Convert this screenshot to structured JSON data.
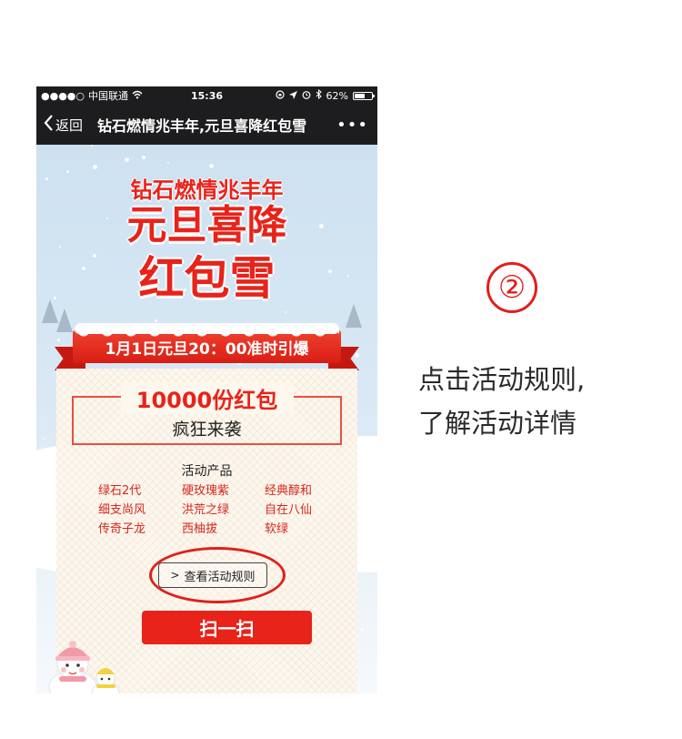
{
  "status_bar": {
    "signal": "●●●●○",
    "carrier": "中国联通",
    "wifi_icon": "wifi-icon",
    "time": "15:36",
    "battery_percent": "62%",
    "battery_level": 0.62
  },
  "nav": {
    "back_label": "返回",
    "title": "钻石燃情兆丰年,元旦喜降红包雪",
    "more_label": "•••"
  },
  "hero": {
    "line1": "钻石燃情兆丰年",
    "line2": "元旦喜降",
    "line3": "红包雪"
  },
  "ribbon": {
    "text": "1月1日元旦20：00准时引爆"
  },
  "card": {
    "prize_amount": "10000份红包",
    "prize_sub": "疯狂来袭",
    "products_title": "活动产品",
    "products": [
      "绿石2代",
      "硬玫瑰紫",
      "经典醇和",
      "细支尚风",
      "洪荒之绿",
      "自在八仙",
      "传奇子龙",
      "西柚拔",
      "软绿"
    ],
    "rules_button": "查看活动规则",
    "scan_button": "扫一扫"
  },
  "annotation": {
    "step": "②",
    "line1": "点击活动规则,",
    "line2": "了解活动详情"
  },
  "colors": {
    "accent_red": "#e8231a",
    "navbar_bg": "#1d1d1f",
    "card_bg": "#fdf7ee"
  }
}
